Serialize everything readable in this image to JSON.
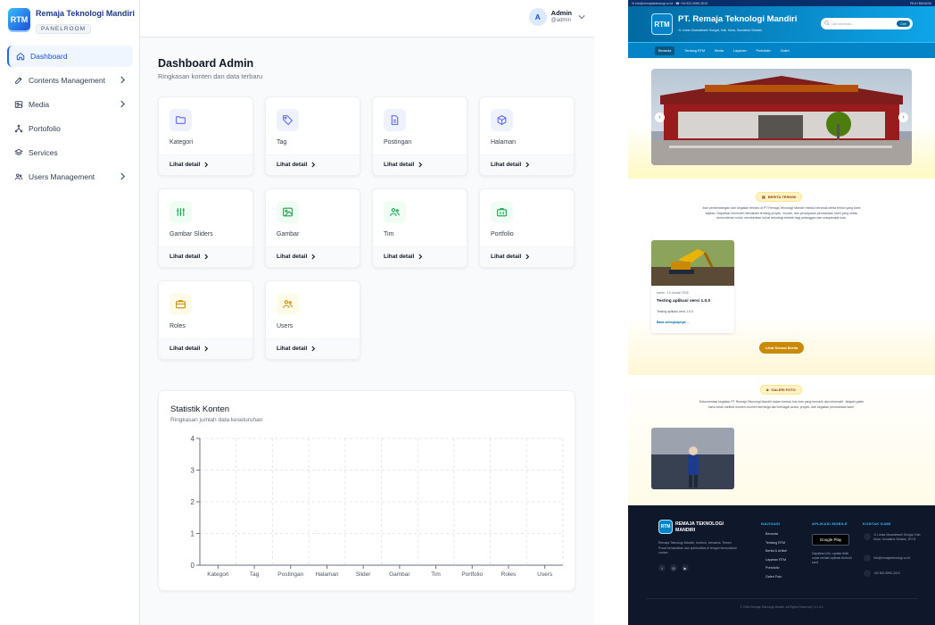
{
  "brand": {
    "name": "Remaja Teknologi Mandiri",
    "tag": "PANELROOM",
    "logo_text": "RTM"
  },
  "colors": {
    "primary": "#2563eb",
    "active_bg": "#eff6ff",
    "site_blue": "#0284c7",
    "site_gold": "#ca8a04",
    "footer_bg": "#0f172a"
  },
  "sidebar": {
    "items": [
      {
        "label": "Dashboard",
        "icon": "home-icon",
        "active": true,
        "has_children": false
      },
      {
        "label": "Contents Management",
        "icon": "edit-icon",
        "active": false,
        "has_children": true
      },
      {
        "label": "Media",
        "icon": "image-icon",
        "active": false,
        "has_children": true
      },
      {
        "label": "Portofolio",
        "icon": "network-icon",
        "active": false,
        "has_children": false
      },
      {
        "label": "Services",
        "icon": "layers-icon",
        "active": false,
        "has_children": false
      },
      {
        "label": "Users Management",
        "icon": "users-icon",
        "active": false,
        "has_children": true
      }
    ]
  },
  "user": {
    "initial": "A",
    "name": "Admin",
    "handle": "@admin"
  },
  "page": {
    "title": "Dashboard Admin",
    "subtitle": "Ringkasan konten dan data terbaru"
  },
  "cards": [
    {
      "label": "Kategori",
      "link": "Lihat detail",
      "icon": "folder-icon",
      "color": "#6366f1",
      "tint": "#eef2ff"
    },
    {
      "label": "Tag",
      "link": "Lihat detail",
      "icon": "tag-icon",
      "color": "#6366f1",
      "tint": "#eef2ff"
    },
    {
      "label": "Postingan",
      "link": "Lihat detail",
      "icon": "document-icon",
      "color": "#6366f1",
      "tint": "#eef2ff"
    },
    {
      "label": "Halaman",
      "link": "Lihat detail",
      "icon": "cube-icon",
      "color": "#6366f1",
      "tint": "#eef2ff"
    },
    {
      "label": "Gambar Sliders",
      "link": "Lihat detail",
      "icon": "sliders-icon",
      "color": "#16a34a",
      "tint": "#f0fdf4"
    },
    {
      "label": "Gambar",
      "link": "Lihat detail",
      "icon": "picture-icon",
      "color": "#16a34a",
      "tint": "#f0fdf4"
    },
    {
      "label": "Tim",
      "link": "Lihat detail",
      "icon": "team-icon",
      "color": "#16a34a",
      "tint": "#f0fdf4"
    },
    {
      "label": "Portfolio",
      "link": "Lihat detail",
      "icon": "briefcase-icon",
      "color": "#16a34a",
      "tint": "#f0fdf4"
    },
    {
      "label": "Roles",
      "link": "Lihat detail",
      "icon": "role-briefcase-icon",
      "color": "#ca8a04",
      "tint": "#fefce8"
    },
    {
      "label": "Users",
      "link": "Lihat detail",
      "icon": "user-group-icon",
      "color": "#ca8a04",
      "tint": "#fefce8"
    }
  ],
  "stats": {
    "title": "Statistik Konten",
    "subtitle": "Ringkasan jumlah data keseluruhan"
  },
  "chart_data": {
    "type": "bar",
    "title": "Statistik Konten",
    "subtitle": "Ringkasan jumlah data keseluruhan",
    "categories": [
      "Kategori",
      "Tag",
      "Postingan",
      "Halaman",
      "Slider",
      "Gambar",
      "Tim",
      "Portfolio",
      "Roles",
      "Users"
    ],
    "values": [
      0,
      0,
      0,
      0,
      0,
      0,
      0,
      0,
      0,
      0
    ],
    "yticks": [
      0,
      1,
      2,
      3,
      4
    ],
    "ylim": [
      0,
      4
    ],
    "grid": true
  },
  "site": {
    "topbar_left": "✉ info@remajateknologi.co.id · ☎ +62 821-5990-3010",
    "topbar_right": "PILIH BAHASA",
    "title": "PT. Remaja Teknologi Mandiri",
    "address": "Jl. Lintas Muarateweh Sungai, Kab. Mura, Sumatera Selatan",
    "search_placeholder": "Cari informasi...",
    "search_button": "Cari",
    "nav": [
      "Beranda",
      "Tentang RTM",
      "Berita",
      "Layanan",
      "Portofolio",
      "Galeri"
    ],
    "news_chip": "BERITA TERKINI",
    "news_text": "Ikuti perkembangan dan kegiatan terbaru di PT Remaja Teknologi Mandiri melalui beranda berita terkini yang kami sajikan. Dapatkan informasi mendalam tentang proyek, inovasi, dan pencapaian perusahaan kami yang selalu berkomitmen untuk memberikan solusi teknologi terbaik bagi pelanggan dan masyarakat luas.",
    "news_meta": "admin · 14 Januari 2026",
    "news_title": "Testing aplikasi versi 1.0.0",
    "news_excerpt": "Testing aplikasi versi 1.0.0",
    "news_link": "Baca selengkapnya →",
    "news_button": "Lihat Semua Berita",
    "gallery_chip": "GALERI FOTO",
    "gallery_text": "Dokumentasi kegiatan PT Remaja Teknologi Mandiri dalam bentuk foto-foto yang menarik dan informatif. Jelajahi galeri kami untuk melihat momen-momen berharga dari berbagai acara, proyek, dan kegiatan perusahaan kami.",
    "footer_brand": "REMAJA TEKNOLOGI MANDIRI",
    "footer_desc": "Remaja Teknologi Mandiri, tumbuh, bersama. Temen Pusat kehandalan dan spiritualitas di tengah kemudahan zaman.",
    "footer_nav_title": "NAVIGASI",
    "footer_nav": [
      "Beranda",
      "Tentang RTM",
      "Berita & Artikel",
      "Layanan RTM",
      "Portofolio",
      "Galeri Foto"
    ],
    "footer_app_title": "APLIKASI MOBILE",
    "footer_app_badge": "Google Play",
    "footer_app_text": "Dapatkan info, update lebih cepat melalui aplikasi Android kami",
    "footer_contact_title": "KONTAK KAMI",
    "footer_contact": [
      "Jl. Lintas Muarateweh Sungai, Kab. Mura, Sumatera Selatan, 30711",
      "info@remajateknologi.co.id",
      "+62 821-5990-3010"
    ],
    "copyright": "© 2026 Remaja Teknologi Mandiri. All Rights Reserved | V.1.0.0"
  }
}
